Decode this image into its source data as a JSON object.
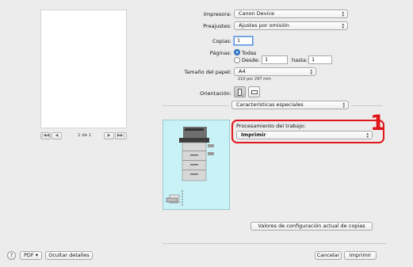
{
  "preview": {
    "page_indicator": "1 de 1",
    "nav_first": "|◀◀",
    "nav_prev": "◀",
    "nav_next": "▶",
    "nav_last": "▶▶|"
  },
  "form": {
    "printer_label": "Impresora:",
    "printer_value": "Canon Device",
    "presets_label": "Preajustes:",
    "presets_value": "Ajustes por omisión",
    "copies_label": "Copias:",
    "copies_value": "1",
    "pages_label": "Páginas:",
    "pages_all": "Todas",
    "pages_from_label": "Desde:",
    "pages_from_value": "1",
    "pages_to_label": "hasta:",
    "pages_to_value": "1",
    "paper_label": "Tamaño del papel:",
    "paper_value": "A4",
    "paper_dims": "210 por 297 mm",
    "orientation_label": "Orientación:",
    "section_value": "Características especiales"
  },
  "job": {
    "processing_label": "Procesamiento del trabajo:",
    "processing_value": "Imprimir",
    "callout_number": "1"
  },
  "buttons": {
    "copy_settings": "Valores de configuración actual de copias",
    "help": "?",
    "pdf": "PDF ▾",
    "hide_details": "Ocultar detalles",
    "cancel": "Cancelar",
    "print": "Imprimir"
  },
  "colors": {
    "accent": "#3b82d6",
    "callout": "#e0161b",
    "panel": "#c9f2f7"
  }
}
